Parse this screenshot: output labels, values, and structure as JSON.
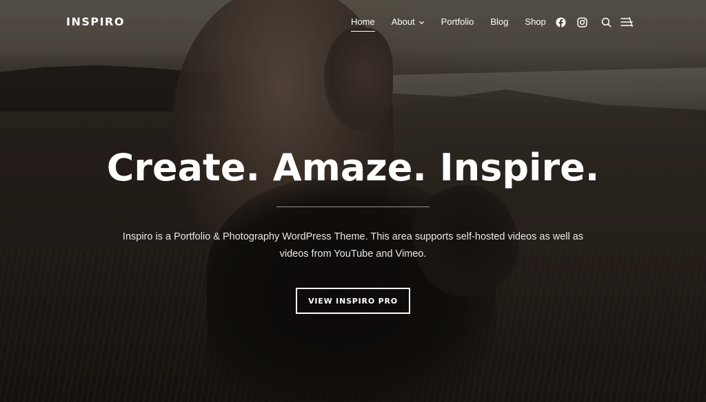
{
  "header": {
    "logo": "INSPIRO",
    "nav": [
      {
        "label": "Home",
        "active": true
      },
      {
        "label": "About",
        "has_dropdown": true
      },
      {
        "label": "Portfolio"
      },
      {
        "label": "Blog"
      },
      {
        "label": "Shop"
      }
    ],
    "icons": [
      "facebook-icon",
      "instagram-icon",
      "search-icon",
      "sidebar-menu-icon"
    ]
  },
  "hero": {
    "headline": "Create. Amaze. Inspire.",
    "description": "Inspiro is a Portfolio & Photography WordPress Theme. This area supports self-hosted videos as well as videos from YouTube and Vimeo.",
    "cta_label": "VIEW INSPIRO PRO"
  },
  "colors": {
    "text": "#ffffff",
    "overlay": "#1a1613"
  }
}
